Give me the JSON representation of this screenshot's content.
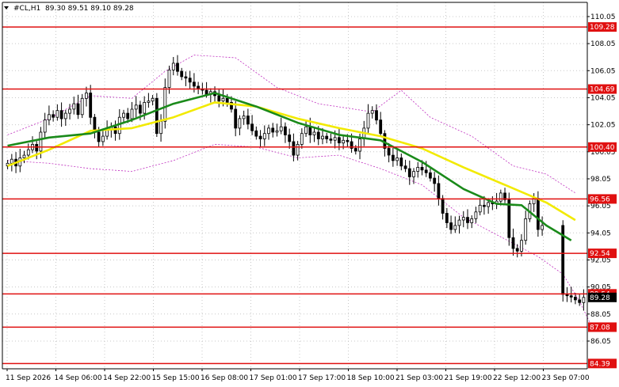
{
  "header": {
    "symbol": "#CL,H1",
    "ohlc": "89.30 89.51 89.10 89.28"
  },
  "colors": {
    "candle": "#000000",
    "level_line": "#e01010",
    "level_badge": "#e01010",
    "ma_fast": "#1a8a1a",
    "ma_slow": "#f2ea00",
    "envelope": "#c030c0",
    "grid": "#c8c8c8",
    "price_badge_bg": "#000000"
  },
  "chart_data": {
    "type": "candlestick",
    "y_range": [
      84.0,
      111.1
    ],
    "y_ticks": [
      {
        "label": "110.05",
        "value": 110.05
      },
      {
        "label": "108.05",
        "value": 108.05
      },
      {
        "label": "106.05",
        "value": 106.05
      },
      {
        "label": "104.05",
        "value": 104.05
      },
      {
        "label": "102.05",
        "value": 102.05
      },
      {
        "label": "100.05",
        "value": 100.05
      },
      {
        "label": "98.05",
        "value": 98.05
      },
      {
        "label": "96.05",
        "value": 96.05
      },
      {
        "label": "94.05",
        "value": 94.05
      },
      {
        "label": "92.05",
        "value": 92.05
      },
      {
        "label": "90.05",
        "value": 90.05
      },
      {
        "label": "88.05",
        "value": 88.05
      },
      {
        "label": "86.05",
        "value": 86.05
      }
    ],
    "x_labels": [
      "11 Sep 2026",
      "14 Sep 06:00",
      "14 Sep 22:00",
      "15 Sep 15:00",
      "16 Sep 08:00",
      "17 Sep 01:00",
      "17 Sep 17:00",
      "18 Sep 10:00",
      "21 Sep 03:00",
      "21 Sep 19:00",
      "22 Sep 12:00",
      "23 Sep 07:00"
    ],
    "levels": [
      {
        "label": "109.28",
        "value": 109.28
      },
      {
        "label": "104.69",
        "value": 104.69
      },
      {
        "label": "100.40",
        "value": 100.4
      },
      {
        "label": "96.56",
        "value": 96.56
      },
      {
        "label": "92.54",
        "value": 92.54
      },
      {
        "label": "89.54",
        "value": 89.54
      },
      {
        "label": "87.08",
        "value": 87.08
      },
      {
        "label": "84.39",
        "value": 84.39
      }
    ],
    "current_price": {
      "label": "89.28",
      "value": 89.28
    },
    "closes": [
      99.2,
      99.5,
      99.0,
      99.6,
      99.8,
      100.2,
      100.6,
      100.1,
      101.5,
      102.4,
      102.8,
      102.6,
      103.1,
      102.5,
      102.9,
      103.2,
      103.6,
      102.8,
      104.0,
      104.4,
      102.6,
      101.5,
      100.8,
      101.2,
      101.7,
      101.9,
      101.4,
      102.6,
      102.9,
      102.5,
      103.2,
      103.5,
      102.9,
      103.7,
      103.8,
      104.0,
      101.4,
      102.3,
      104.8,
      106.1,
      106.6,
      106.0,
      105.6,
      105.5,
      105.2,
      104.9,
      104.7,
      104.6,
      104.3,
      104.5,
      104.2,
      103.8,
      104.0,
      103.7,
      103.2,
      101.8,
      102.5,
      102.7,
      102.1,
      101.6,
      101.2,
      101.0,
      101.4,
      101.8,
      101.5,
      101.6,
      101.9,
      101.3,
      100.8,
      99.8,
      100.6,
      101.4,
      101.9,
      101.3,
      101.5,
      101.0,
      101.2,
      101.0,
      100.9,
      101.1,
      100.7,
      100.9,
      100.8,
      100.3,
      100.1,
      101.0,
      101.8,
      102.9,
      103.1,
      102.4,
      101.4,
      100.3,
      99.8,
      99.4,
      99.6,
      99.0,
      98.8,
      98.2,
      98.6,
      98.9,
      98.7,
      98.5,
      98.1,
      97.7,
      96.6,
      95.5,
      94.8,
      94.3,
      94.6,
      95.0,
      95.2,
      94.8,
      95.1,
      95.6,
      96.1,
      96.0,
      96.3,
      96.2,
      96.4,
      97.0,
      96.5,
      93.7,
      92.9,
      92.7,
      93.5,
      95.1,
      96.2,
      96.6,
      94.3,
      94.6,
      null,
      null,
      null,
      null,
      89.5,
      89.4,
      89.3,
      89.1,
      88.9,
      89.28
    ],
    "ma_fast": [
      {
        "x": 0,
        "y": 100.5
      },
      {
        "x": 10,
        "y": 101.1
      },
      {
        "x": 20,
        "y": 101.4
      },
      {
        "x": 30,
        "y": 102.4
      },
      {
        "x": 40,
        "y": 103.6
      },
      {
        "x": 50,
        "y": 104.4
      },
      {
        "x": 60,
        "y": 103.4
      },
      {
        "x": 70,
        "y": 102.2
      },
      {
        "x": 80,
        "y": 101.3
      },
      {
        "x": 90,
        "y": 100.9
      },
      {
        "x": 100,
        "y": 99.3
      },
      {
        "x": 110,
        "y": 97.3
      },
      {
        "x": 118,
        "y": 96.2
      },
      {
        "x": 124,
        "y": 96.1
      },
      {
        "x": 130,
        "y": 94.6
      },
      {
        "x": 136,
        "y": 93.5
      }
    ],
    "ma_slow": [
      {
        "x": 0,
        "y": 99.0
      },
      {
        "x": 10,
        "y": 100.2
      },
      {
        "x": 20,
        "y": 101.6
      },
      {
        "x": 30,
        "y": 101.8
      },
      {
        "x": 40,
        "y": 102.6
      },
      {
        "x": 50,
        "y": 103.7
      },
      {
        "x": 60,
        "y": 103.4
      },
      {
        "x": 70,
        "y": 102.5
      },
      {
        "x": 80,
        "y": 101.8
      },
      {
        "x": 90,
        "y": 101.2
      },
      {
        "x": 100,
        "y": 100.3
      },
      {
        "x": 110,
        "y": 98.9
      },
      {
        "x": 120,
        "y": 97.6
      },
      {
        "x": 130,
        "y": 96.3
      },
      {
        "x": 137,
        "y": 95.0
      }
    ],
    "envelope_upper": [
      {
        "x": 0,
        "y": 101.3
      },
      {
        "x": 10,
        "y": 102.5
      },
      {
        "x": 20,
        "y": 104.2
      },
      {
        "x": 30,
        "y": 104.0
      },
      {
        "x": 38,
        "y": 106.0
      },
      {
        "x": 45,
        "y": 107.2
      },
      {
        "x": 55,
        "y": 107.0
      },
      {
        "x": 65,
        "y": 104.8
      },
      {
        "x": 75,
        "y": 103.6
      },
      {
        "x": 88,
        "y": 103.0
      },
      {
        "x": 95,
        "y": 104.6
      },
      {
        "x": 102,
        "y": 102.6
      },
      {
        "x": 112,
        "y": 101.2
      },
      {
        "x": 122,
        "y": 99.0
      },
      {
        "x": 130,
        "y": 98.4
      },
      {
        "x": 137,
        "y": 97.0
      }
    ],
    "envelope_lower": [
      {
        "x": 0,
        "y": 99.4
      },
      {
        "x": 10,
        "y": 99.2
      },
      {
        "x": 20,
        "y": 98.8
      },
      {
        "x": 30,
        "y": 98.6
      },
      {
        "x": 40,
        "y": 99.4
      },
      {
        "x": 50,
        "y": 100.6
      },
      {
        "x": 60,
        "y": 100.4
      },
      {
        "x": 70,
        "y": 99.6
      },
      {
        "x": 80,
        "y": 99.8
      },
      {
        "x": 90,
        "y": 98.8
      },
      {
        "x": 100,
        "y": 97.6
      },
      {
        "x": 110,
        "y": 95.2
      },
      {
        "x": 120,
        "y": 93.6
      },
      {
        "x": 128,
        "y": 92.3
      },
      {
        "x": 134,
        "y": 91.0
      },
      {
        "x": 138,
        "y": 89.0
      },
      {
        "x": 141,
        "y": 87.1
      }
    ]
  }
}
